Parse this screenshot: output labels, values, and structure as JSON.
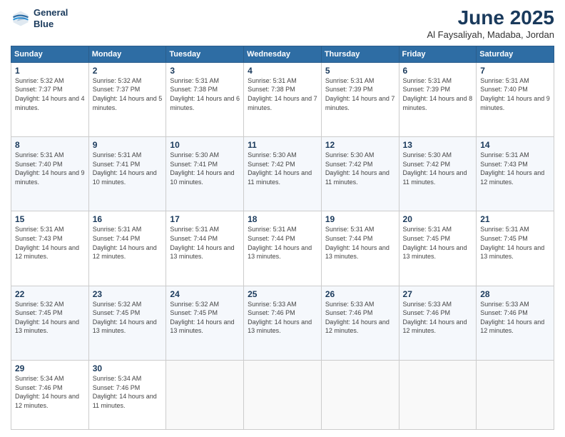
{
  "header": {
    "logo_line1": "General",
    "logo_line2": "Blue",
    "title": "June 2025",
    "subtitle": "Al Faysaliyah, Madaba, Jordan"
  },
  "days_of_week": [
    "Sunday",
    "Monday",
    "Tuesday",
    "Wednesday",
    "Thursday",
    "Friday",
    "Saturday"
  ],
  "weeks": [
    [
      {
        "day": "1",
        "sunrise": "5:32 AM",
        "sunset": "7:37 PM",
        "daylight": "14 hours and 4 minutes."
      },
      {
        "day": "2",
        "sunrise": "5:32 AM",
        "sunset": "7:37 PM",
        "daylight": "14 hours and 5 minutes."
      },
      {
        "day": "3",
        "sunrise": "5:31 AM",
        "sunset": "7:38 PM",
        "daylight": "14 hours and 6 minutes."
      },
      {
        "day": "4",
        "sunrise": "5:31 AM",
        "sunset": "7:38 PM",
        "daylight": "14 hours and 7 minutes."
      },
      {
        "day": "5",
        "sunrise": "5:31 AM",
        "sunset": "7:39 PM",
        "daylight": "14 hours and 7 minutes."
      },
      {
        "day": "6",
        "sunrise": "5:31 AM",
        "sunset": "7:39 PM",
        "daylight": "14 hours and 8 minutes."
      },
      {
        "day": "7",
        "sunrise": "5:31 AM",
        "sunset": "7:40 PM",
        "daylight": "14 hours and 9 minutes."
      }
    ],
    [
      {
        "day": "8",
        "sunrise": "5:31 AM",
        "sunset": "7:40 PM",
        "daylight": "14 hours and 9 minutes."
      },
      {
        "day": "9",
        "sunrise": "5:31 AM",
        "sunset": "7:41 PM",
        "daylight": "14 hours and 10 minutes."
      },
      {
        "day": "10",
        "sunrise": "5:30 AM",
        "sunset": "7:41 PM",
        "daylight": "14 hours and 10 minutes."
      },
      {
        "day": "11",
        "sunrise": "5:30 AM",
        "sunset": "7:42 PM",
        "daylight": "14 hours and 11 minutes."
      },
      {
        "day": "12",
        "sunrise": "5:30 AM",
        "sunset": "7:42 PM",
        "daylight": "14 hours and 11 minutes."
      },
      {
        "day": "13",
        "sunrise": "5:30 AM",
        "sunset": "7:42 PM",
        "daylight": "14 hours and 11 minutes."
      },
      {
        "day": "14",
        "sunrise": "5:31 AM",
        "sunset": "7:43 PM",
        "daylight": "14 hours and 12 minutes."
      }
    ],
    [
      {
        "day": "15",
        "sunrise": "5:31 AM",
        "sunset": "7:43 PM",
        "daylight": "14 hours and 12 minutes."
      },
      {
        "day": "16",
        "sunrise": "5:31 AM",
        "sunset": "7:44 PM",
        "daylight": "14 hours and 12 minutes."
      },
      {
        "day": "17",
        "sunrise": "5:31 AM",
        "sunset": "7:44 PM",
        "daylight": "14 hours and 13 minutes."
      },
      {
        "day": "18",
        "sunrise": "5:31 AM",
        "sunset": "7:44 PM",
        "daylight": "14 hours and 13 minutes."
      },
      {
        "day": "19",
        "sunrise": "5:31 AM",
        "sunset": "7:44 PM",
        "daylight": "14 hours and 13 minutes."
      },
      {
        "day": "20",
        "sunrise": "5:31 AM",
        "sunset": "7:45 PM",
        "daylight": "14 hours and 13 minutes."
      },
      {
        "day": "21",
        "sunrise": "5:31 AM",
        "sunset": "7:45 PM",
        "daylight": "14 hours and 13 minutes."
      }
    ],
    [
      {
        "day": "22",
        "sunrise": "5:32 AM",
        "sunset": "7:45 PM",
        "daylight": "14 hours and 13 minutes."
      },
      {
        "day": "23",
        "sunrise": "5:32 AM",
        "sunset": "7:45 PM",
        "daylight": "14 hours and 13 minutes."
      },
      {
        "day": "24",
        "sunrise": "5:32 AM",
        "sunset": "7:45 PM",
        "daylight": "14 hours and 13 minutes."
      },
      {
        "day": "25",
        "sunrise": "5:33 AM",
        "sunset": "7:46 PM",
        "daylight": "14 hours and 13 minutes."
      },
      {
        "day": "26",
        "sunrise": "5:33 AM",
        "sunset": "7:46 PM",
        "daylight": "14 hours and 12 minutes."
      },
      {
        "day": "27",
        "sunrise": "5:33 AM",
        "sunset": "7:46 PM",
        "daylight": "14 hours and 12 minutes."
      },
      {
        "day": "28",
        "sunrise": "5:33 AM",
        "sunset": "7:46 PM",
        "daylight": "14 hours and 12 minutes."
      }
    ],
    [
      {
        "day": "29",
        "sunrise": "5:34 AM",
        "sunset": "7:46 PM",
        "daylight": "14 hours and 12 minutes."
      },
      {
        "day": "30",
        "sunrise": "5:34 AM",
        "sunset": "7:46 PM",
        "daylight": "14 hours and 11 minutes."
      },
      null,
      null,
      null,
      null,
      null
    ]
  ],
  "labels": {
    "sunrise": "Sunrise:",
    "sunset": "Sunset:",
    "daylight": "Daylight:"
  }
}
